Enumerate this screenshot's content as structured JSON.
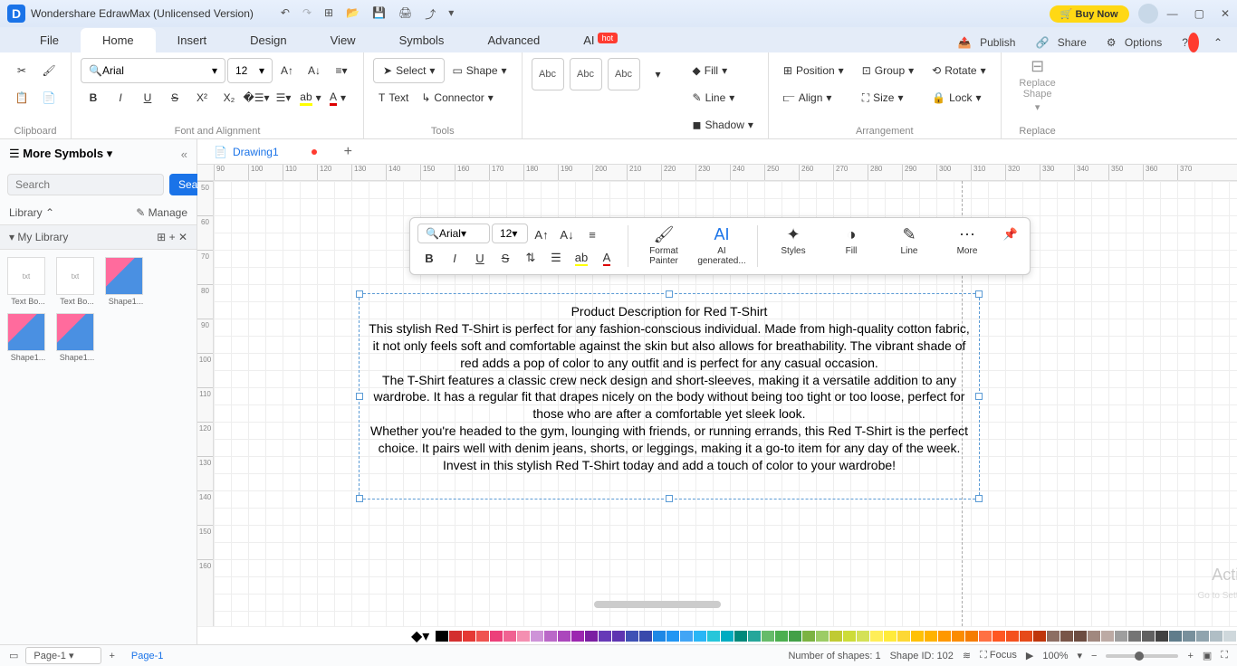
{
  "app": {
    "title": "Wondershare EdrawMax (Unlicensed Version)",
    "buy_now": "Buy Now"
  },
  "menus": {
    "file": "File",
    "home": "Home",
    "insert": "Insert",
    "design": "Design",
    "view": "View",
    "symbols": "Symbols",
    "advanced": "Advanced",
    "ai": "AI",
    "hot": "hot",
    "publish": "Publish",
    "share": "Share",
    "options": "Options"
  },
  "ribbon": {
    "clipboard": "Clipboard",
    "font_alignment": "Font and Alignment",
    "tools": "Tools",
    "styles": "Styles",
    "arrangement": "Arrangement",
    "replace": "Replace",
    "font_name": "Arial",
    "font_size": "12",
    "select": "Select",
    "shape": "Shape",
    "text": "Text",
    "connector": "Connector",
    "abc": "Abc",
    "fill": "Fill",
    "line": "Line",
    "shadow": "Shadow",
    "position": "Position",
    "align": "Align",
    "group": "Group",
    "size": "Size",
    "rotate": "Rotate",
    "lock": "Lock",
    "replace_shape": "Replace\nShape"
  },
  "sidebar": {
    "more_symbols": "More Symbols",
    "search_ph": "Search",
    "search_btn": "Search",
    "library": "Library",
    "manage": "Manage",
    "my_library": "My Library",
    "items": [
      {
        "label": "Text Bo..."
      },
      {
        "label": "Text Bo..."
      },
      {
        "label": "Shape1..."
      },
      {
        "label": "Shape1..."
      },
      {
        "label": "Shape1..."
      }
    ]
  },
  "doc": {
    "tab": "Drawing1"
  },
  "ruler_h": [
    "90",
    "100",
    "110",
    "120",
    "130",
    "140",
    "150",
    "160",
    "170",
    "180",
    "190",
    "200",
    "210",
    "220",
    "230",
    "240",
    "250",
    "260",
    "270",
    "280",
    "290",
    "300",
    "310",
    "320",
    "330",
    "340",
    "350",
    "360",
    "370"
  ],
  "ruler_v": [
    "50",
    "60",
    "70",
    "80",
    "90",
    "100",
    "110",
    "120",
    "130",
    "140",
    "150",
    "160"
  ],
  "textbox": {
    "title": "Product Description for Red T-Shirt",
    "p1": "This stylish Red T-Shirt is perfect for any fashion-conscious individual. Made from high-quality cotton fabric, it not only feels soft and comfortable against the skin but also allows for breathability. The vibrant shade of red adds a pop of color to any outfit and is perfect for any casual occasion.",
    "p2": "The T-Shirt features a classic crew neck design and short-sleeves, making it a versatile addition to any wardrobe. It has a regular fit that drapes nicely on the body without being too tight or too loose, perfect for those who are after a comfortable yet sleek look.",
    "p3": "Whether you're headed to the gym, lounging with friends, or running errands, this Red T-Shirt is the perfect choice. It pairs well with denim jeans, shorts, or leggings, making it a go-to item for any day of the week.",
    "p4": "Invest in this stylish Red T-Shirt today and add a touch of color to your wardrobe!"
  },
  "float": {
    "font_name": "Arial",
    "font_size": "12",
    "format_painter": "Format\nPainter",
    "ai_generated": "AI\ngenerated...",
    "styles": "Styles",
    "fill": "Fill",
    "line": "Line",
    "more": "More"
  },
  "status": {
    "page_combo": "Page-1",
    "page_tab": "Page-1",
    "shapes": "Number of shapes: 1",
    "shape_id": "Shape ID: 102",
    "focus": "Focus",
    "zoom": "100%"
  },
  "watermark": "Activate Windows",
  "watermark2": "Go to Settings to activate Windows.",
  "colors": [
    "#000",
    "#d32f2f",
    "#e53935",
    "#ef5350",
    "#ec407a",
    "#f06292",
    "#f48fb1",
    "#ce93d8",
    "#ba68c8",
    "#ab47bc",
    "#9c27b0",
    "#7b1fa2",
    "#673ab7",
    "#5e35b1",
    "#3f51b5",
    "#3949ab",
    "#1e88e5",
    "#2196f3",
    "#42a5f5",
    "#29b6f6",
    "#26c6da",
    "#00acc1",
    "#00897b",
    "#26a69a",
    "#66bb6a",
    "#4caf50",
    "#43a047",
    "#7cb342",
    "#9ccc65",
    "#c0ca33",
    "#cddc39",
    "#d4e157",
    "#ffee58",
    "#ffeb3b",
    "#fdd835",
    "#ffc107",
    "#ffb300",
    "#ff9800",
    "#fb8c00",
    "#f57c00",
    "#ff7043",
    "#ff5722",
    "#f4511e",
    "#e64a19",
    "#bf360c",
    "#8d6e63",
    "#795548",
    "#6d4c41",
    "#a1887f",
    "#bcaaa4",
    "#9e9e9e",
    "#757575",
    "#616161",
    "#424242",
    "#607d8b",
    "#78909c",
    "#90a4ae",
    "#b0bec5",
    "#cfd8dc",
    "#263238",
    "#37474f",
    "#455a64",
    "#546e7a",
    "#1a237e",
    "#0d47a1",
    "#01579b",
    "#004d40",
    "#1b5e20"
  ]
}
